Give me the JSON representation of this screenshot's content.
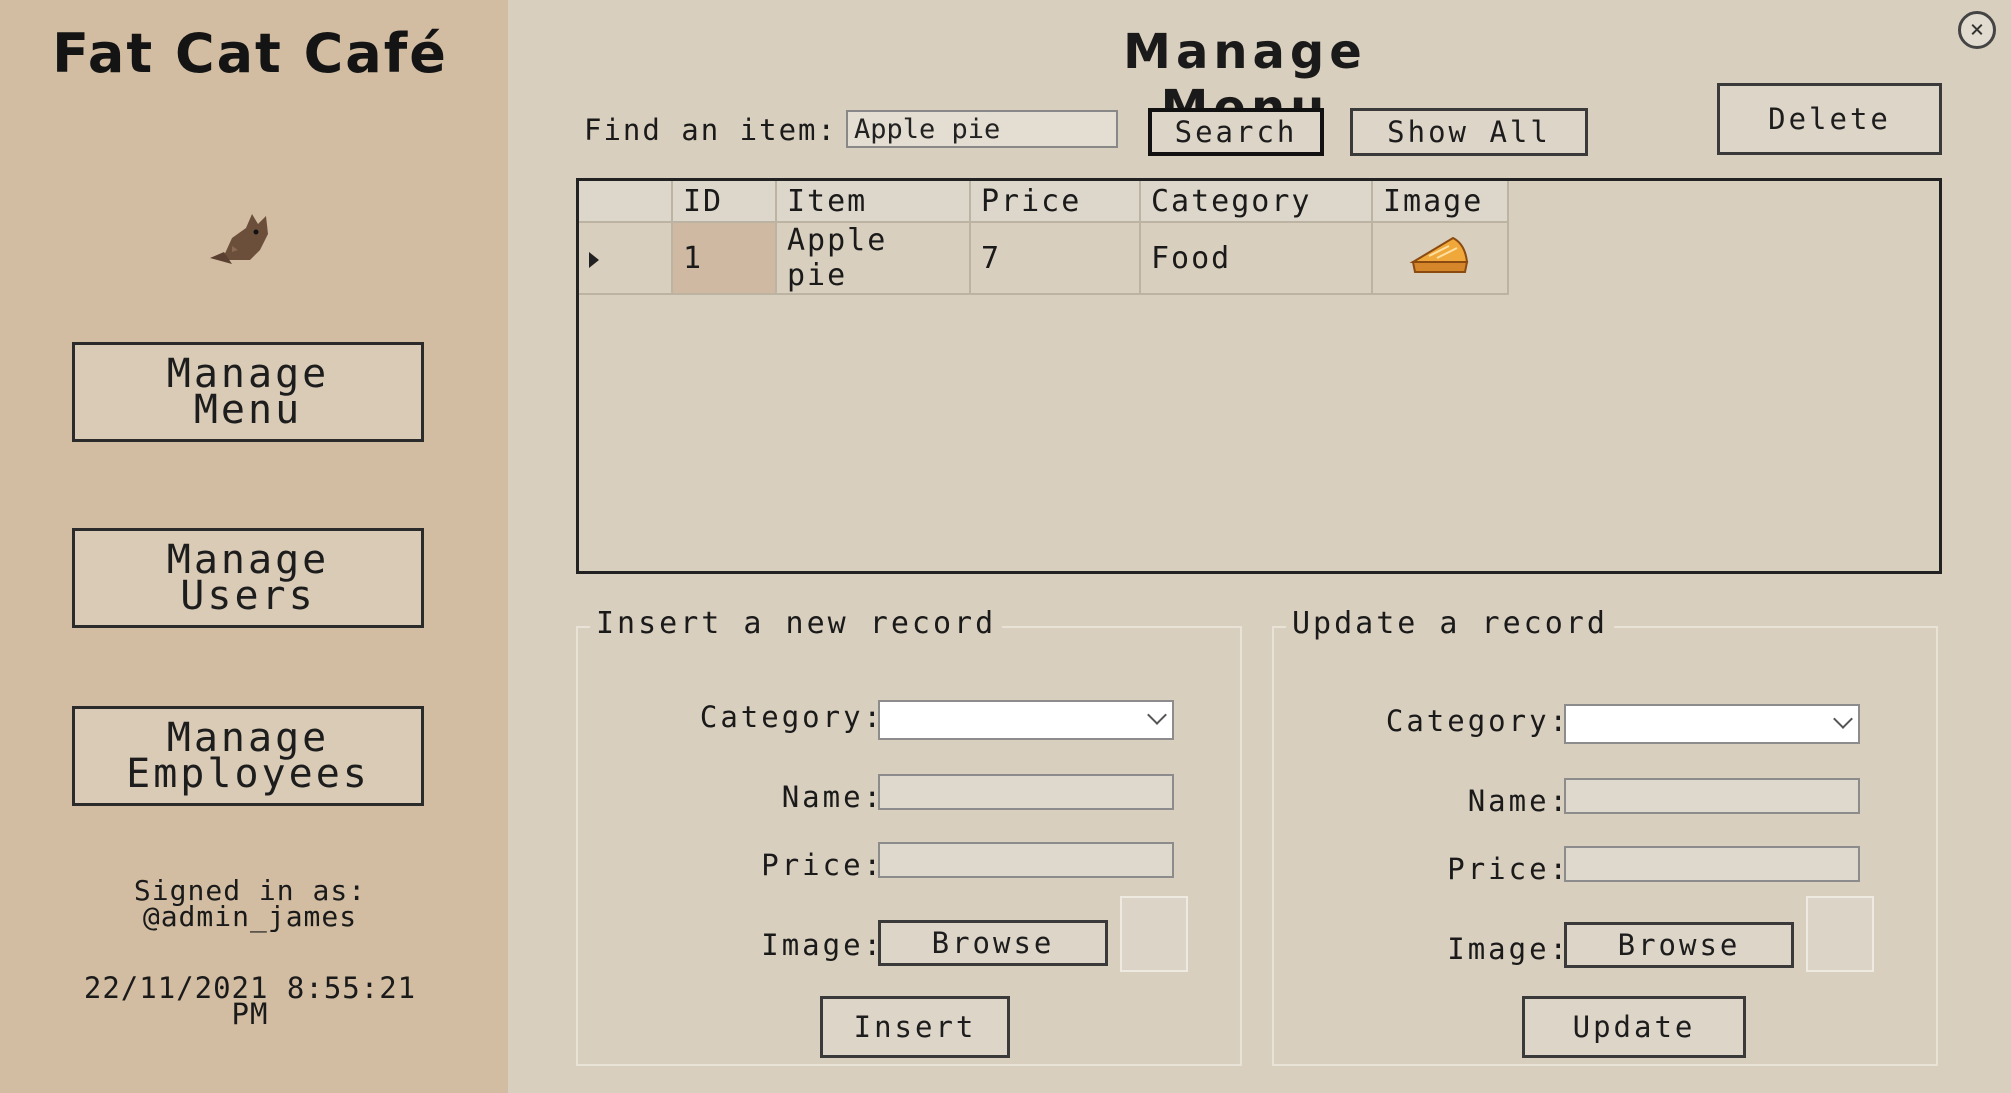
{
  "sidebar": {
    "app_title": "Fat Cat Café",
    "nav": [
      {
        "label": "Manage\nMenu"
      },
      {
        "label": "Manage\nUsers"
      },
      {
        "label": "Manage\nEmployees"
      }
    ],
    "signed_in": "Signed in as:\n@admin_james",
    "datetime": "22/11/2021 8:55:21\nPM"
  },
  "header": {
    "title": "Manage  Menu",
    "close_glyph": "×"
  },
  "search": {
    "label": "Find an item:",
    "value": "Apple pie",
    "search_label": "Search",
    "show_all_label": "Show All",
    "delete_label": "Delete"
  },
  "grid": {
    "columns": [
      "",
      "ID",
      "Item",
      "Price",
      "Category",
      "Image"
    ],
    "rows": [
      {
        "id": "1",
        "item": "Apple pie",
        "price": "7",
        "category": "Food",
        "image_icon": "pie-slice-icon"
      }
    ]
  },
  "insert": {
    "title": "Insert a new record",
    "category_label": "Category:",
    "name_label": "Name:",
    "price_label": "Price:",
    "image_label": "Image:",
    "browse_label": "Browse",
    "action_label": "Insert"
  },
  "update": {
    "title": "Update a record",
    "category_label": "Category:",
    "name_label": "Name:",
    "price_label": "Price:",
    "image_label": "Image:",
    "browse_label": "Browse",
    "action_label": "Update"
  },
  "colors": {
    "sidebar_bg": "#d2bda2",
    "main_bg": "#d9cfbe",
    "id_cell_bg": "#cfb9a2"
  },
  "icons": {
    "logo": "cat-icon",
    "close": "close-icon",
    "row_indicator": "row-arrow-icon",
    "dropdown": "chevron-down-icon"
  }
}
